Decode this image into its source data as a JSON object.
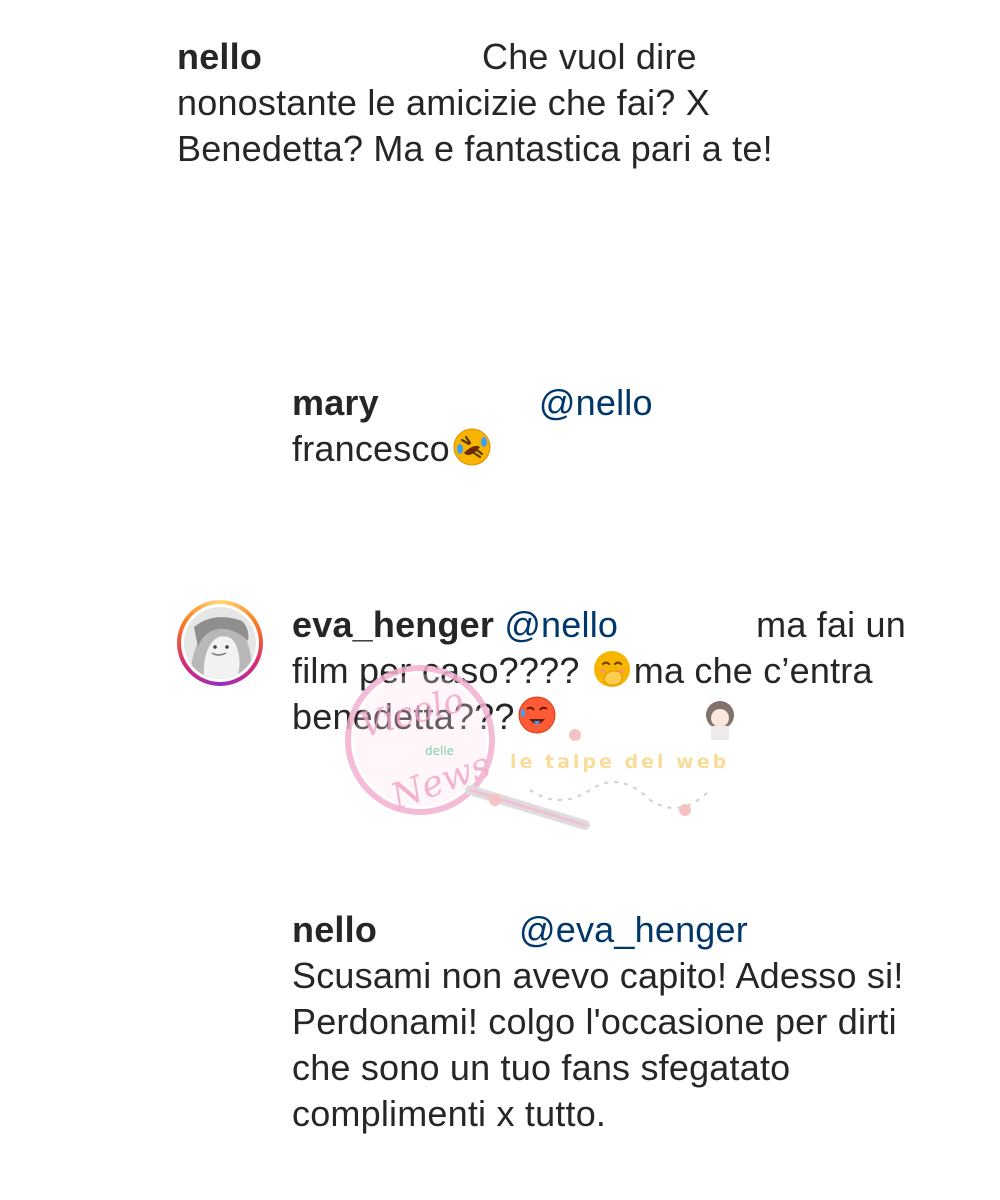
{
  "comments": [
    {
      "username": "nello",
      "text_line1": "Che vuol dire nonostante",
      "text_rest": "le amicizie che fai? X Benedetta? Ma e fantastica pari a te!"
    },
    {
      "username": "mary",
      "mention": "@nello",
      "text": "francesco",
      "emoji": "rolling-on-floor-laughing-emoji"
    },
    {
      "username": "eva_henger",
      "mention": "@nello",
      "text_part1": "ma fai un film per caso????",
      "emoji1": "face-with-hand-over-mouth-emoji",
      "text_part2": "ma che c’entra benedetta???",
      "emoji2": "hot-face-emoji"
    },
    {
      "username": "nello",
      "mention": "@eva_henger",
      "text": "Scusami non avevo capito! Adesso si! Perdonami! colgo l'occasione  per dirti che sono un tuo fans sfegatato complimenti x tutto."
    }
  ],
  "watermark": {
    "logo_text_1": "Vicolo",
    "logo_text_2": "delle",
    "logo_text_3": "News",
    "tagline": "le talpe del web"
  },
  "colors": {
    "text": "#262626",
    "mention": "#00376b",
    "background": "#ffffff"
  }
}
